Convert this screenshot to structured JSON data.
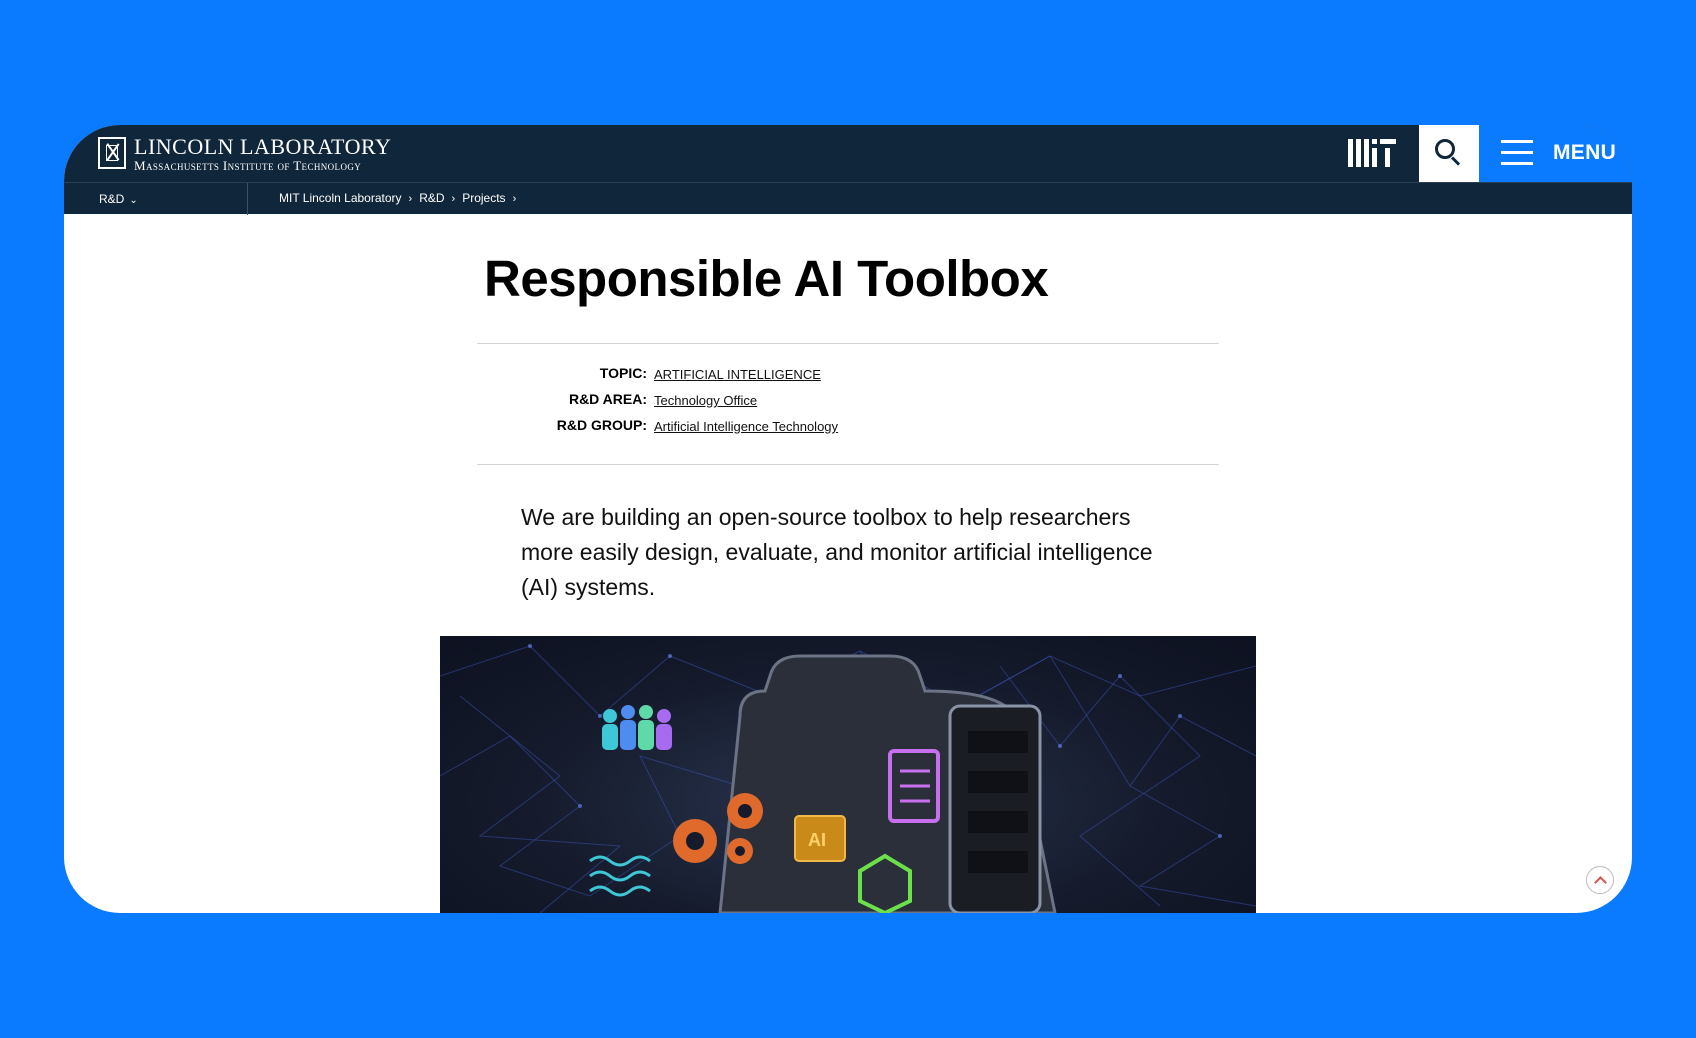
{
  "header": {
    "logo_title": "LINCOLN LABORATORY",
    "logo_subtitle": "Massachusetts Institute of Technology",
    "mit_logo": "MIT logo",
    "menu_label": "MENU"
  },
  "subnav": {
    "section": "R&D",
    "breadcrumb": [
      "MIT Lincoln Laboratory",
      "R&D",
      "Projects"
    ]
  },
  "page": {
    "title": "Responsible AI Toolbox",
    "meta": [
      {
        "label": "TOPIC:",
        "value": "ARTIFICIAL INTELLIGENCE"
      },
      {
        "label": "R&D AREA:",
        "value": "Technology Office"
      },
      {
        "label": "R&D GROUP:",
        "value": "Artificial Intelligence Technology"
      }
    ],
    "intro": "We are building an open-source toolbox to help researchers more easily design, evaluate, and monitor artificial intelligence (AI) systems."
  },
  "colors": {
    "background": "#0a7aff",
    "navbar": "#10263a",
    "menu_button": "#0a7aff"
  },
  "icons": {
    "search": "search-icon",
    "menu": "hamburger-icon",
    "scroll_top": "chevron-up-icon"
  }
}
